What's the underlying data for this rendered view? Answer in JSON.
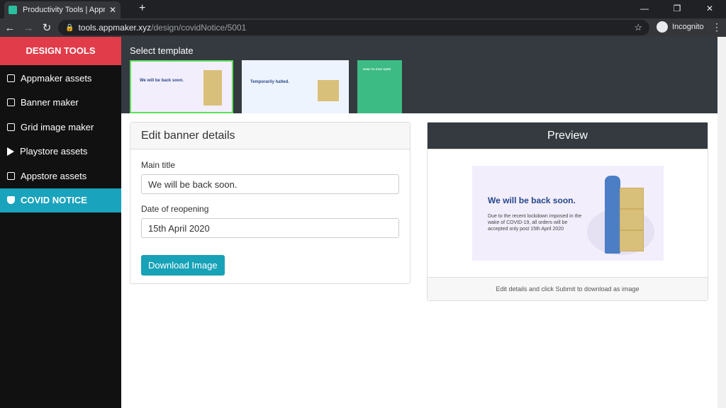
{
  "browser": {
    "tab_title": "Productivity Tools | Appmaker.xyz",
    "url_host": "tools.appmaker.xyz",
    "url_path": "/design/covidNotice/5001",
    "incognito": "Incognito"
  },
  "sidebar": {
    "title": "DESIGN TOOLS",
    "items": [
      {
        "label": "Appmaker assets",
        "icon": "phone-icon"
      },
      {
        "label": "Banner maker",
        "icon": "image-icon"
      },
      {
        "label": "Grid image maker",
        "icon": "images-icon"
      },
      {
        "label": "Playstore assets",
        "icon": "play-icon"
      },
      {
        "label": "Appstore assets",
        "icon": "appstore-icon"
      },
      {
        "label": "COVID NOTICE",
        "icon": "shield-icon",
        "active": true
      }
    ]
  },
  "templates": {
    "heading": "Select template",
    "items": [
      {
        "title": "We will be back soon.",
        "selected": true
      },
      {
        "title": "Temporarily halted."
      },
      {
        "title": "HOW TO STAY SAFE"
      }
    ]
  },
  "edit": {
    "heading": "Edit banner details",
    "main_title_label": "Main title",
    "main_title_value": "We will be back soon.",
    "date_label": "Date of reopening",
    "date_value": "15th April 2020",
    "download": "Download Image"
  },
  "preview": {
    "heading": "Preview",
    "banner_title": "We will be back soon.",
    "banner_body": "Due to the recent lockdown imposed in the wake of COVID-19, all orders will be accepted only post 15th April 2020",
    "footer": "Edit details and click Submit to download as image"
  },
  "colors": {
    "accent": "#17a2b8",
    "sidebar_header": "#e03c4a",
    "selected_border": "#5de05a"
  }
}
